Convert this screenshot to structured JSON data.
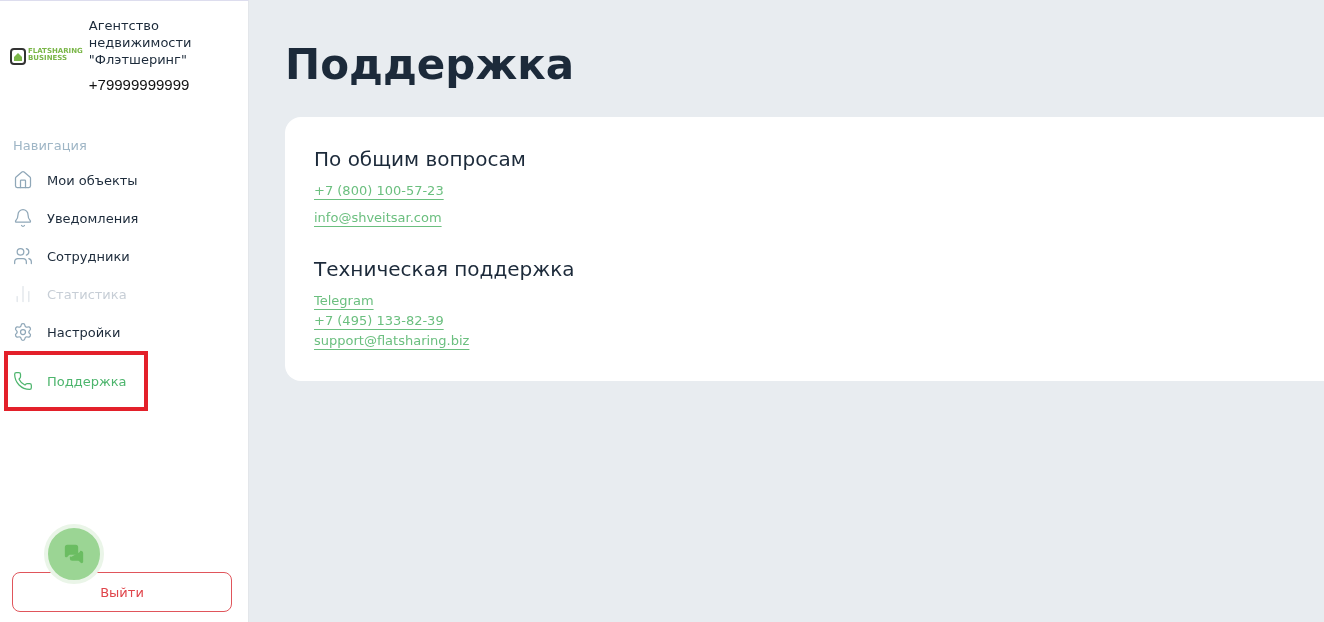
{
  "sidebar": {
    "logo": {
      "line_1": "FLATSHARING",
      "line_2": "BUSINESS"
    },
    "company": {
      "name": "Агентство недвижимости \"Флэтшеринг\"",
      "phone": "+79999999999"
    },
    "nav_title": "Навигация",
    "items": [
      {
        "label": "Мои объекты",
        "kind": "home",
        "selected": false,
        "disabled": false,
        "highlighted": false
      },
      {
        "label": "Уведомления",
        "kind": "bell",
        "selected": false,
        "disabled": false,
        "highlighted": false
      },
      {
        "label": "Сотрудники",
        "kind": "users",
        "selected": false,
        "disabled": false,
        "highlighted": false
      },
      {
        "label": "Статистика",
        "kind": "chart",
        "selected": false,
        "disabled": true,
        "highlighted": false
      },
      {
        "label": "Настройки",
        "kind": "gear",
        "selected": false,
        "disabled": false,
        "highlighted": false
      },
      {
        "label": "Поддержка",
        "kind": "phone",
        "selected": true,
        "disabled": false,
        "highlighted": true
      }
    ],
    "logout": "Выйти"
  },
  "page": {
    "title": "Поддержка",
    "sections": [
      {
        "heading": "По общим вопросам",
        "links": [
          "+7 (800) 100-57-23",
          "info@shveitsar.com"
        ]
      },
      {
        "heading": "Техническая поддержка",
        "links": [
          "Telegram",
          "+7 (495) 133-82-39",
          "support@flatsharing.biz"
        ]
      }
    ]
  }
}
